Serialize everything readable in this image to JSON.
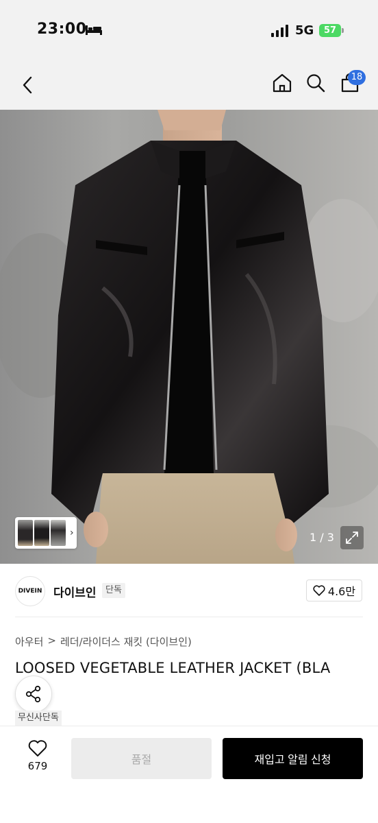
{
  "status_bar": {
    "time": "23:00",
    "network": "5G",
    "battery": "57"
  },
  "nav": {
    "cart_badge": "18"
  },
  "gallery": {
    "page_indicator": "1 / 3"
  },
  "brand": {
    "logo_text": "DIVEIN",
    "name": "다이브인",
    "tag": "단독",
    "likes": "4.6만"
  },
  "breadcrumb": {
    "category": "아우터",
    "separator": ">",
    "subcategory": "레더/라이더스 재킷 (다이브인)"
  },
  "product": {
    "title": "LOOSED VEGETABLE LEATHER JACKET (BLA",
    "badge": "무신사단독"
  },
  "bottom": {
    "wish_count": "679",
    "soldout_label": "품절",
    "restock_label": "재입고 알림 신청"
  },
  "colors": {
    "accent": "#2f6fe0",
    "battery": "#4cd964"
  },
  "icons": [
    "bed-icon",
    "signal-icon",
    "back-icon",
    "home-icon",
    "search-icon",
    "cart-icon",
    "expand-icon",
    "heart-icon",
    "share-icon"
  ]
}
